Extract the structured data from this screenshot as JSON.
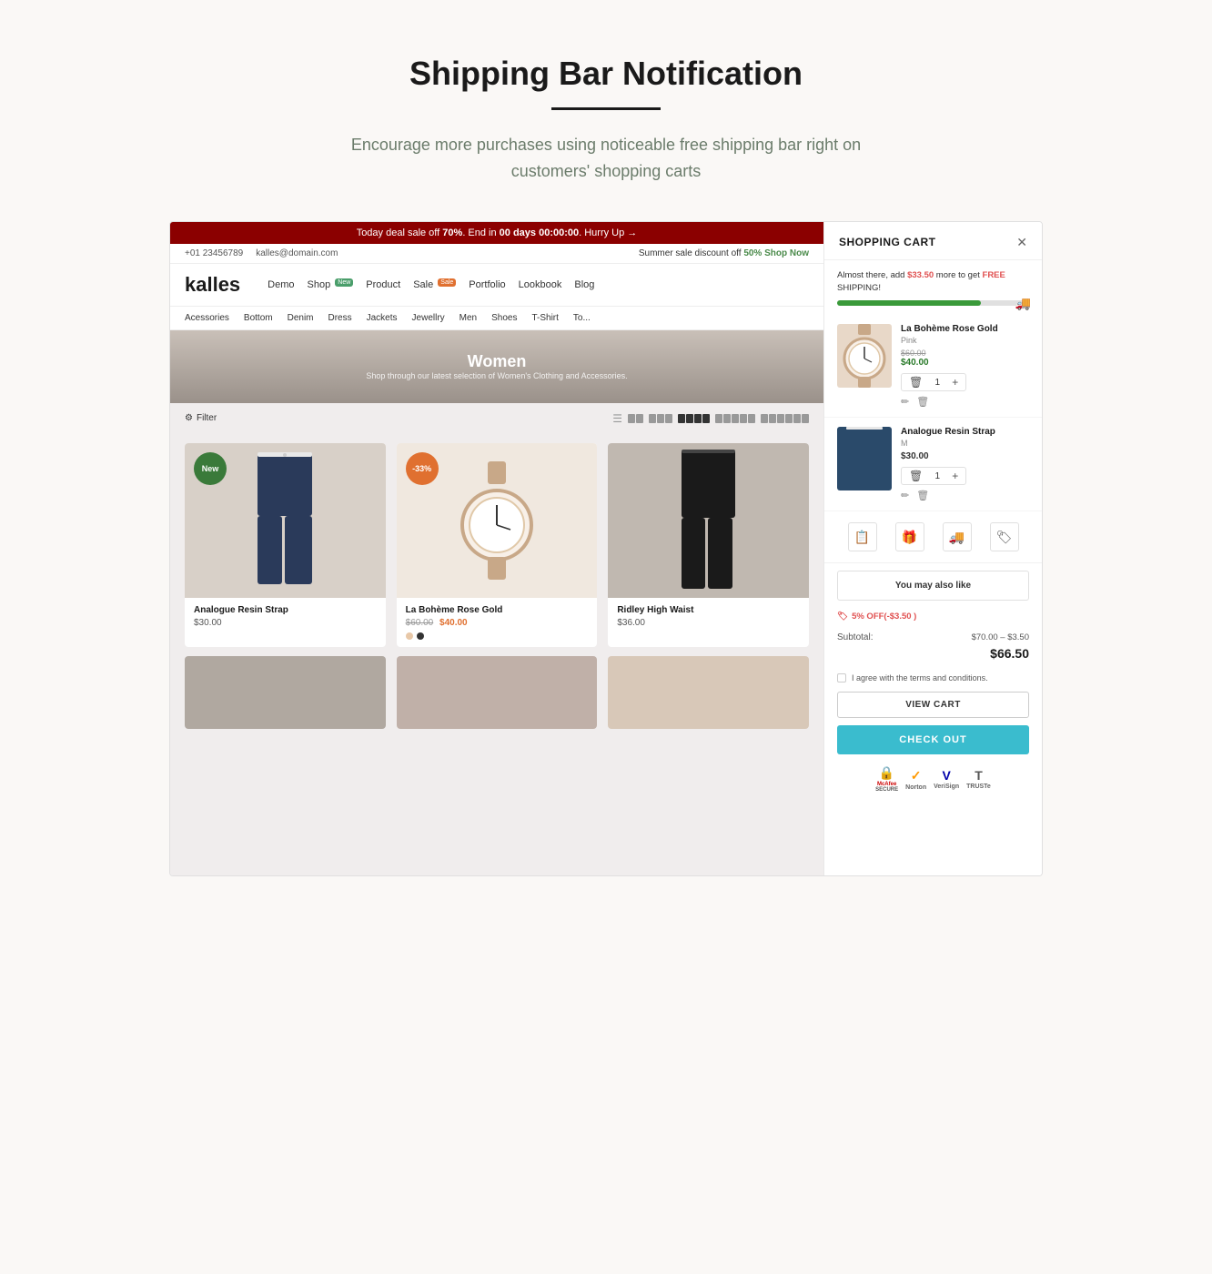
{
  "page": {
    "title": "Shipping Bar Notification",
    "subtitle": "Encourage more purchases using noticeable free shipping bar right on customers' shopping carts",
    "title_underline": true
  },
  "store": {
    "deal_bar": {
      "text_before": "Today deal sale off ",
      "percent": "70%",
      "text_middle": ". End in ",
      "countdown": "00 days 00:00:00",
      "text_after": ". Hurry Up →"
    },
    "contact_bar": {
      "phone": "+01 23456789",
      "email": "kalles@domain.com",
      "summer_sale": "Summer sale discount off ",
      "discount": "50%",
      "shop_now": "Shop Now"
    },
    "logo": "kalles",
    "nav_items": [
      {
        "label": "Demo",
        "badge": null
      },
      {
        "label": "Shop",
        "badge": "new"
      },
      {
        "label": "Product",
        "badge": null
      },
      {
        "label": "Sale",
        "badge": "sale"
      },
      {
        "label": "Portfolio",
        "badge": null
      },
      {
        "label": "Lookbook",
        "badge": null
      },
      {
        "label": "Blog",
        "badge": null
      }
    ],
    "categories": [
      "Acessories",
      "Bottom",
      "Denim",
      "Dress",
      "Jackets",
      "Jewellry",
      "Men",
      "Shoes",
      "T-Shirt",
      "To..."
    ],
    "hero": {
      "title": "Women",
      "subtitle": "Shop through our latest selection of Women's Clothing and Accessories."
    },
    "filter_label": "Filter",
    "products": [
      {
        "name": "Analogue Resin Strap",
        "price": "$30.00",
        "old_price": null,
        "badge": "New",
        "badge_type": "new",
        "color": "#2a4a6a",
        "type": "pants"
      },
      {
        "name": "La Bohème Rose Gold",
        "price": "$40.00",
        "old_price": "$60.00",
        "badge": "-33%",
        "badge_type": "discount",
        "color": "#e8d8c8",
        "type": "watch"
      },
      {
        "name": "Ridley High Waist",
        "price": "$36.00",
        "old_price": null,
        "badge": null,
        "badge_type": null,
        "color": "#1a1a1a",
        "type": "pants-dark"
      }
    ]
  },
  "cart": {
    "title": "SHOPPING CART",
    "shipping_notice": {
      "text": "Almost there, add ",
      "amount": "$33.50",
      "text2": " more to get ",
      "free": "FREE",
      "text3": " SHIPPING!"
    },
    "progress_percent": 75,
    "items": [
      {
        "name": "La Bohème Rose Gold",
        "variant": "Pink",
        "old_price": "$60.00",
        "price": "$40.00",
        "qty": 1,
        "type": "watch"
      },
      {
        "name": "Analogue Resin Strap",
        "variant": "M",
        "price": "$30.00",
        "qty": 1,
        "type": "pants"
      }
    ],
    "utils": [
      "clipboard",
      "gift",
      "truck",
      "tag"
    ],
    "also_like_label": "You may also like",
    "discount": {
      "badge": "🏷",
      "label": "5% OFF(-$3.50 )"
    },
    "subtotal_label": "Subtotal:",
    "subtotal_calc": "$70.00 – $3.50",
    "subtotal_total": "$66.50",
    "terms": "I agree with the terms and conditions.",
    "view_cart_label": "VIEW CART",
    "checkout_label": "CHECK OUT",
    "trust_badges": [
      {
        "label": "McAfee\nSECURE",
        "icon": "🔒"
      },
      {
        "label": "Norton",
        "icon": "✓"
      },
      {
        "label": "VeriSign",
        "icon": "✓"
      },
      {
        "label": "TRUSTe",
        "icon": "✓"
      }
    ]
  }
}
